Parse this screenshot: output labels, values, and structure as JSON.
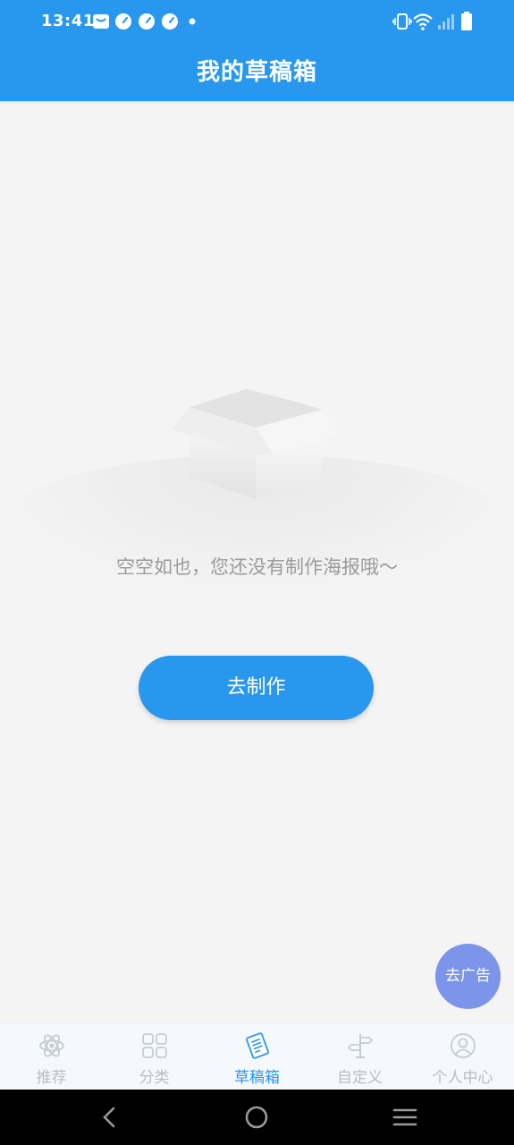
{
  "status_bar": {
    "time": "13:41",
    "icons": [
      "mail-icon",
      "speedometer-icon",
      "speedometer-icon",
      "speedometer-icon",
      "dot-icon",
      "vibrate-icon",
      "wifi-icon",
      "signal-icon",
      "battery-icon"
    ]
  },
  "header": {
    "title": "我的草稿箱"
  },
  "empty_state": {
    "icon": "empty-box-icon",
    "message": "空空如也，您还没有制作海报哦～",
    "action_label": "去制作"
  },
  "floating": {
    "ad_label": "去广告"
  },
  "tabs": [
    {
      "label": "推荐",
      "icon": "atom-icon",
      "active": false
    },
    {
      "label": "分类",
      "icon": "grid-icon",
      "active": false
    },
    {
      "label": "草稿箱",
      "icon": "draft-icon",
      "active": true
    },
    {
      "label": "自定义",
      "icon": "signpost-icon",
      "active": false
    },
    {
      "label": "个人中心",
      "icon": "user-icon",
      "active": false
    }
  ],
  "colors": {
    "primary": "#2897ee",
    "background": "#f4f4f4",
    "ad_button": "#7c94ea",
    "tab_inactive": "#b8bec6"
  }
}
